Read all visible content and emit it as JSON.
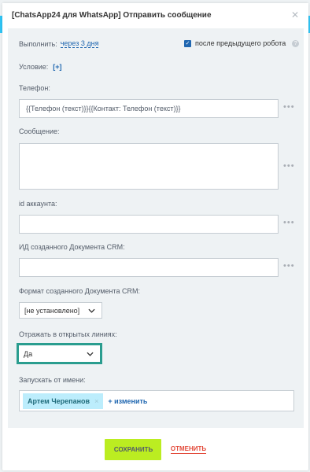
{
  "dialog": {
    "title": "[ChatsApp24 для WhatsApp] Отправить сообщение",
    "close_icon": "close-icon"
  },
  "execute": {
    "label": "Выполнить:",
    "value": "через 3 дня",
    "checkbox_checked": true,
    "checkbox_label": "после предыдущего робота",
    "help": "?"
  },
  "condition": {
    "label": "Условие:",
    "add": "[+]"
  },
  "phone": {
    "label": "Телефон:",
    "value": "{{Телефон (текст)}}{{Контакт: Телефон (текст)}}",
    "menu": "•••"
  },
  "message": {
    "label": "Сообщение:",
    "value": "",
    "menu": "•••"
  },
  "account_id": {
    "label": "id аккаунта:",
    "value": "",
    "menu": "•••"
  },
  "doc_id": {
    "label": "ИД созданного Документа CRM:",
    "value": "",
    "menu": "•••"
  },
  "doc_format": {
    "label": "Формат созданного Документа CRM:",
    "value": "[не установлено]"
  },
  "open_lines": {
    "label": "Отражать в открытых линиях:",
    "value": "Да"
  },
  "run_as": {
    "label": "Запускать от имени:",
    "user": "Артем Черепанов",
    "remove": "×",
    "change": "+ изменить"
  },
  "footer": {
    "save": "СОХРАНИТЬ",
    "cancel": "ОТМЕНИТЬ"
  },
  "colors": {
    "accent": "#2067b0",
    "save_button": "#bbed21",
    "cancel": "#e34a3a",
    "focus_border": "#2a9d8f"
  }
}
